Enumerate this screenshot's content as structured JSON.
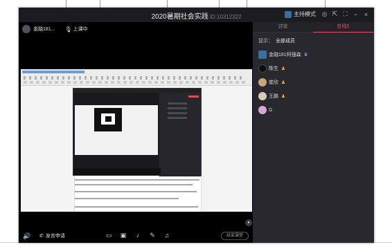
{
  "window": {
    "title": "2020暑期社会实践",
    "room_id": "ID:10312322",
    "host_mode_label": "主持模式"
  },
  "presenter": {
    "name": "金融181...",
    "status": "上课中"
  },
  "controls": {
    "phone_label": "发言申请",
    "end_label": "结束课堂"
  },
  "panel": {
    "tabs": [
      {
        "label": "讨论",
        "active": false
      },
      {
        "label": "在线5",
        "active": true
      }
    ],
    "filter_label": "显示：",
    "filter_value": "全部成员",
    "members": [
      {
        "name": "金融181阿强森",
        "avatar_color": "#3e6f9c",
        "badge": "host-badge-icon"
      },
      {
        "name": "陈生",
        "avatar_color": "#1a1a1a",
        "badge": "student-badge-icon"
      },
      {
        "name": "崔欣",
        "avatar_color": "#c9a67a",
        "badge": "student-badge-icon"
      },
      {
        "name": "王鹏",
        "avatar_color": "#d8c9b8",
        "badge": "student-badge-icon"
      },
      {
        "name": "G",
        "avatar_color": "#d7a6d6",
        "badge": ""
      }
    ]
  },
  "colors": {
    "accent": "#e05469",
    "window_bg": "#16161a",
    "panel_bg": "#28282e"
  }
}
